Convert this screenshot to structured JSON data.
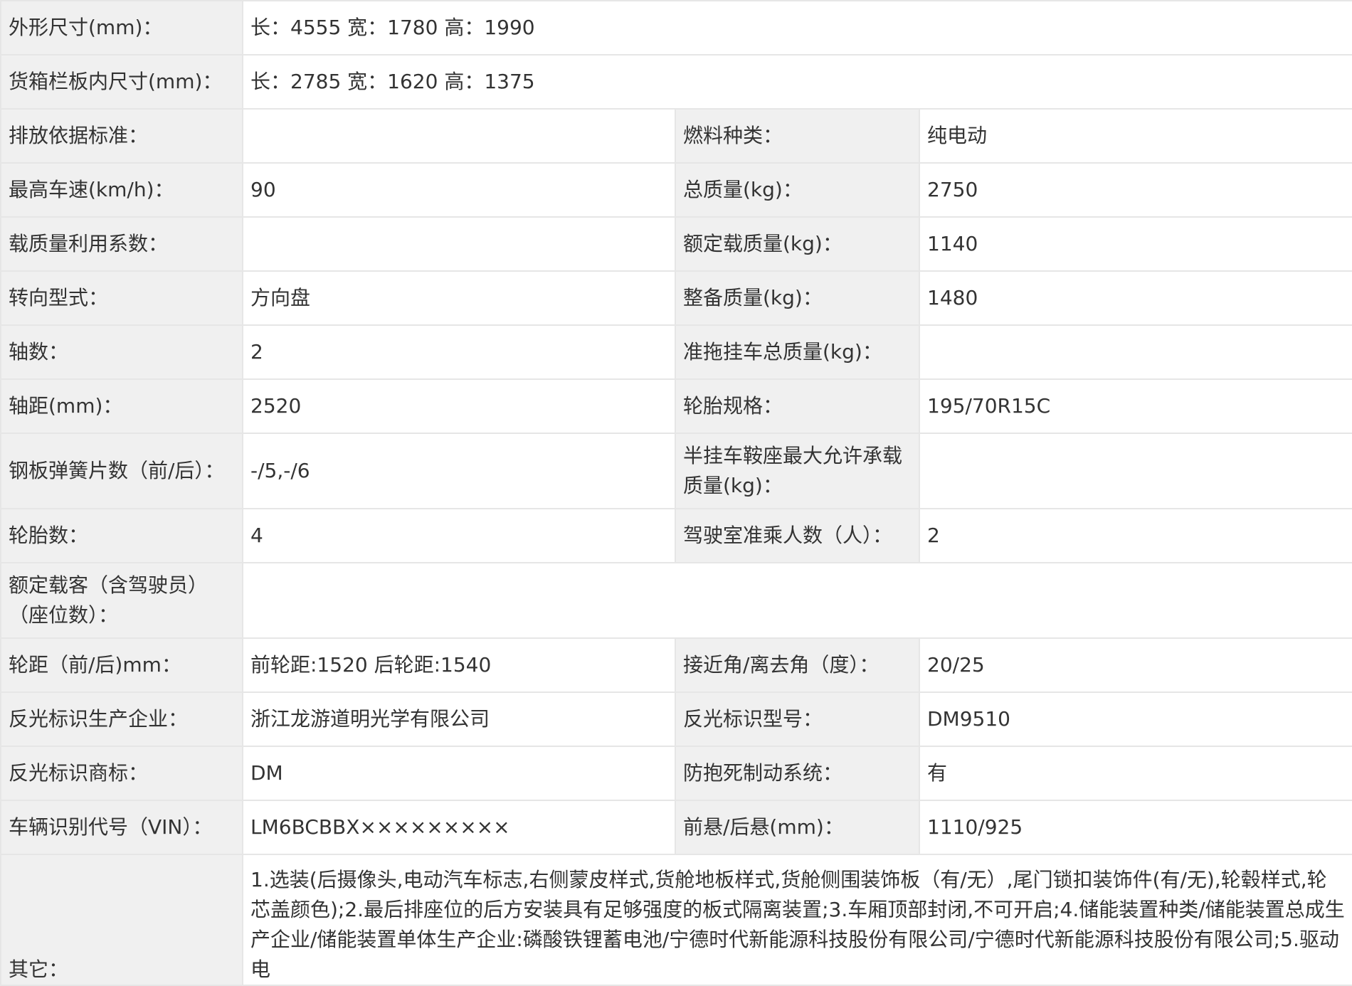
{
  "rows": [
    {
      "label": "外形尺寸(mm)：",
      "value": "长：4555 宽：1780 高：1990"
    },
    {
      "label": "货箱栏板内尺寸(mm)：",
      "value": "长：2785 宽：1620 高：1375"
    },
    {
      "label": "排放依据标准：",
      "value": "",
      "label2": "燃料种类：",
      "value2": "纯电动"
    },
    {
      "label": "最高车速(km/h)：",
      "value": "90",
      "label2": "总质量(kg)：",
      "value2": "2750"
    },
    {
      "label": "载质量利用系数：",
      "value": "",
      "label2": "额定载质量(kg)：",
      "value2": "1140"
    },
    {
      "label": "转向型式：",
      "value": "方向盘",
      "label2": "整备质量(kg)：",
      "value2": "1480"
    },
    {
      "label": "轴数：",
      "value": "2",
      "label2": "准拖挂车总质量(kg)：",
      "value2": ""
    },
    {
      "label": "轴距(mm)：",
      "value": "2520",
      "label2": "轮胎规格：",
      "value2": "195/70R15C"
    },
    {
      "label": "钢板弹簧片数（前/后）：",
      "value": "-/5,-/6",
      "label2": "半挂车鞍座最大允许承载质量(kg)：",
      "value2": ""
    },
    {
      "label": "轮胎数：",
      "value": "4",
      "label2": "驾驶室准乘人数（人）：",
      "value2": "2"
    },
    {
      "label": "额定载客（含驾驶员）（座位数）：",
      "value": ""
    },
    {
      "label": "轮距（前/后)mm：",
      "value": "前轮距:1520 后轮距:1540",
      "label2": "接近角/离去角（度）：",
      "value2": "20/25"
    },
    {
      "label": "反光标识生产企业：",
      "value": "浙江龙游道明光学有限公司",
      "label2": "反光标识型号：",
      "value2": "DM9510"
    },
    {
      "label": "反光标识商标：",
      "value": "DM",
      "label2": "防抱死制动系统：",
      "value2": "有"
    },
    {
      "label": "车辆识别代号（VIN）：",
      "value": "LM6BCBBX×××××××××",
      "label2": "前悬/后悬(mm)：",
      "value2": "1110/925"
    },
    {
      "label": "其它：",
      "value": "1.选装(后摄像头,电动汽车标志,右侧蒙皮样式,货舱地板样式,货舱侧围装饰板（有/无）,尾门锁扣装饰件(有/无),轮毂样式,轮芯盖颜色);2.最后排座位的后方安装具有足够强度的板式隔离装置;3.车厢顶部封闭,不可开启;4.储能装置种类/储能装置总成生产企业/储能装置单体生产企业:磷酸铁锂蓄电池/宁德时代新能源科技股份有限公司/宁德时代新能源科技股份有限公司;5.驱动电"
    }
  ]
}
